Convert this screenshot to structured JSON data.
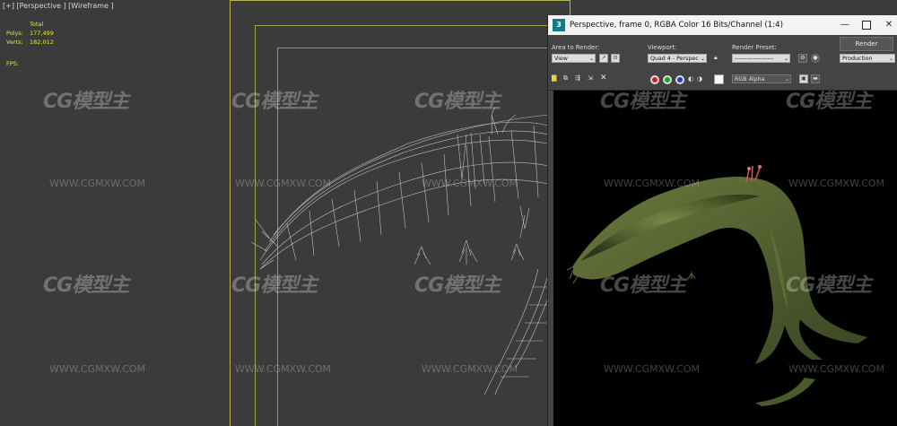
{
  "viewport": {
    "label": "[+] [Perspective ] [Wireframe ]",
    "stats": {
      "total_label": "Total",
      "polys_label": "Polys:",
      "polys_value": "177,499",
      "verts_label": "Verts:",
      "verts_value": "182,012",
      "fps_label": "FPS:"
    },
    "frame_colors": {
      "safe_outer": "#b8b04a",
      "safe_mid": "#8fb04a",
      "safe_inner": "#4aa8b0"
    }
  },
  "watermark": {
    "logo": "CG模型主",
    "url": "WWW.CGMXW.COM"
  },
  "render_window": {
    "title": "Perspective, frame 0, RGBA Color 16 Bits/Channel (1:4)",
    "app_icon": "3",
    "area_to_render_label": "Area to Render:",
    "area_to_render_value": "View",
    "viewport_label": "Viewport:",
    "viewport_value": "Quad 4 - Perspec",
    "render_preset_label": "Render Preset:",
    "render_preset_value": "-------------------",
    "render_button": "Render",
    "render_mode_value": "Production",
    "channel_value": "RGB Alpha",
    "colors": {
      "red": "#d52020",
      "green": "#20a020",
      "blue": "#2040c0"
    }
  }
}
